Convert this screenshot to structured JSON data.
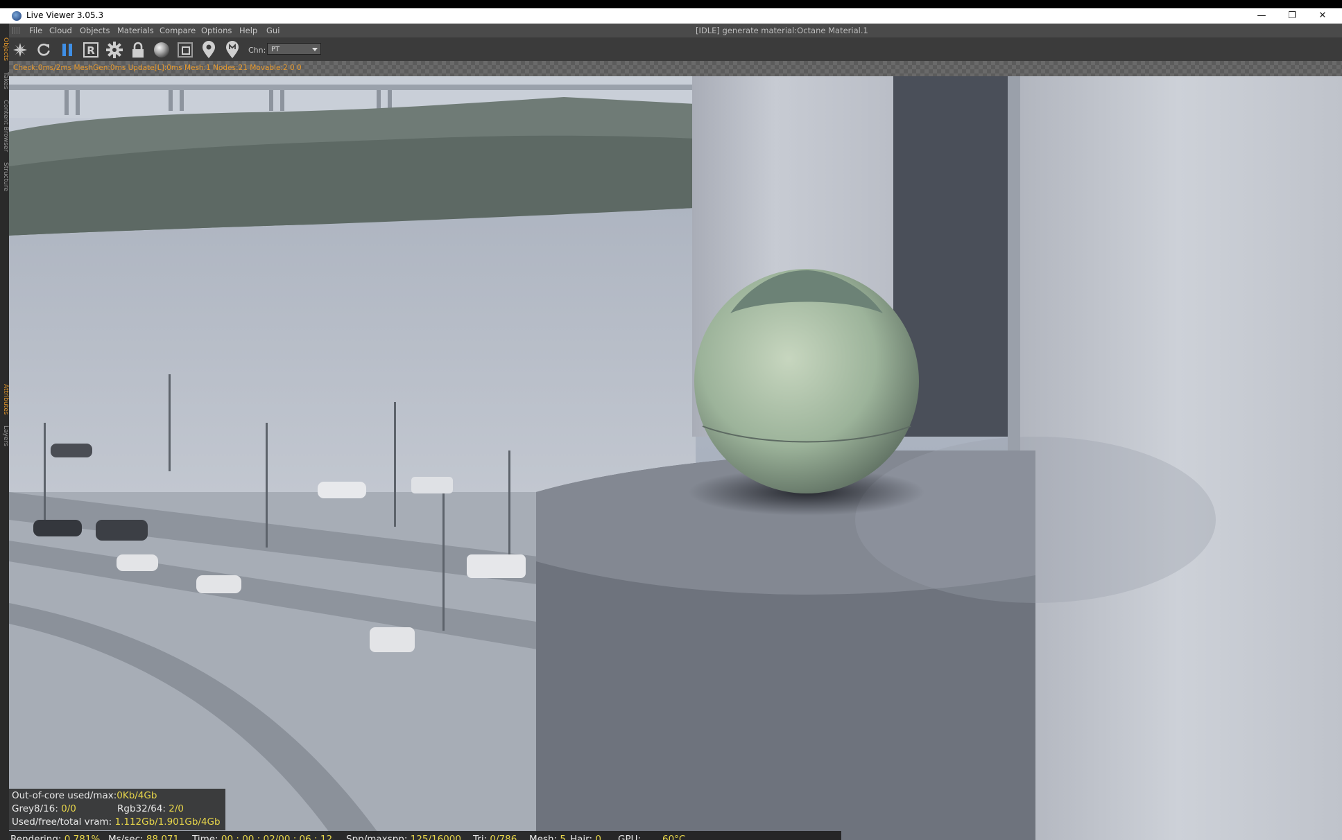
{
  "window": {
    "title": "Live Viewer 3.05.3",
    "minimize": "—",
    "restore": "❐",
    "close": "✕"
  },
  "menu": {
    "items": [
      "File",
      "Cloud",
      "Objects",
      "Materials",
      "Compare",
      "Options",
      "Help",
      "Gui"
    ],
    "status": "[IDLE] generate material:Octane Material.1"
  },
  "left_tabs": [
    "Objects",
    "Takes",
    "Content Browser",
    "Structure",
    "Attributes",
    "Layers"
  ],
  "toolbar": {
    "icons": [
      "octane-logo-icon",
      "refresh-icon",
      "pause-icon",
      "render-region-icon",
      "settings-gear-icon",
      "lock-icon",
      "material-ball-icon",
      "film-region-icon",
      "pick-focus-icon",
      "pick-material-icon"
    ],
    "render_region_glyph": "R",
    "chn_label": "Chn:",
    "chn_value": "PT"
  },
  "stats_line": "Check:0ms/2ms  MeshGen:0ms  Update[L]:0ms  Mesh:1  Nodes:21  Movable:2  0 0",
  "hud": {
    "outofcore_label": "Out-of-core used/max:",
    "outofcore_value": "0Kb/4Gb",
    "grey_label": "Grey8/16:",
    "grey_value": "0/0",
    "rgb_label": "Rgb32/64:",
    "rgb_value": "2/0",
    "vram_label": "Used/free/total vram:",
    "vram_value": "1.112Gb/1.901Gb/4Gb"
  },
  "render_status": {
    "rendering_label": "Rendering:",
    "rendering_value": "0.781%",
    "mssec_label": "Ms/sec:",
    "mssec_value": "88.071",
    "time_label": "Time:",
    "time_value": "00 : 00 : 02/00 : 06 : 12",
    "spp_label": "Spp/maxspp:",
    "spp_value": "125/16000",
    "tri_label": "Tri:",
    "tri_value": "0/786",
    "mesh_label": "Mesh:",
    "mesh_value": "5",
    "hair_label": "Hair:",
    "hair_value": "0",
    "gpu_label": "GPU:",
    "gpu_value": "60°C"
  },
  "colors": {
    "accent_orange": "#e79a2e",
    "value_yellow": "#e8d64a",
    "pause_blue": "#3f8fe6"
  }
}
